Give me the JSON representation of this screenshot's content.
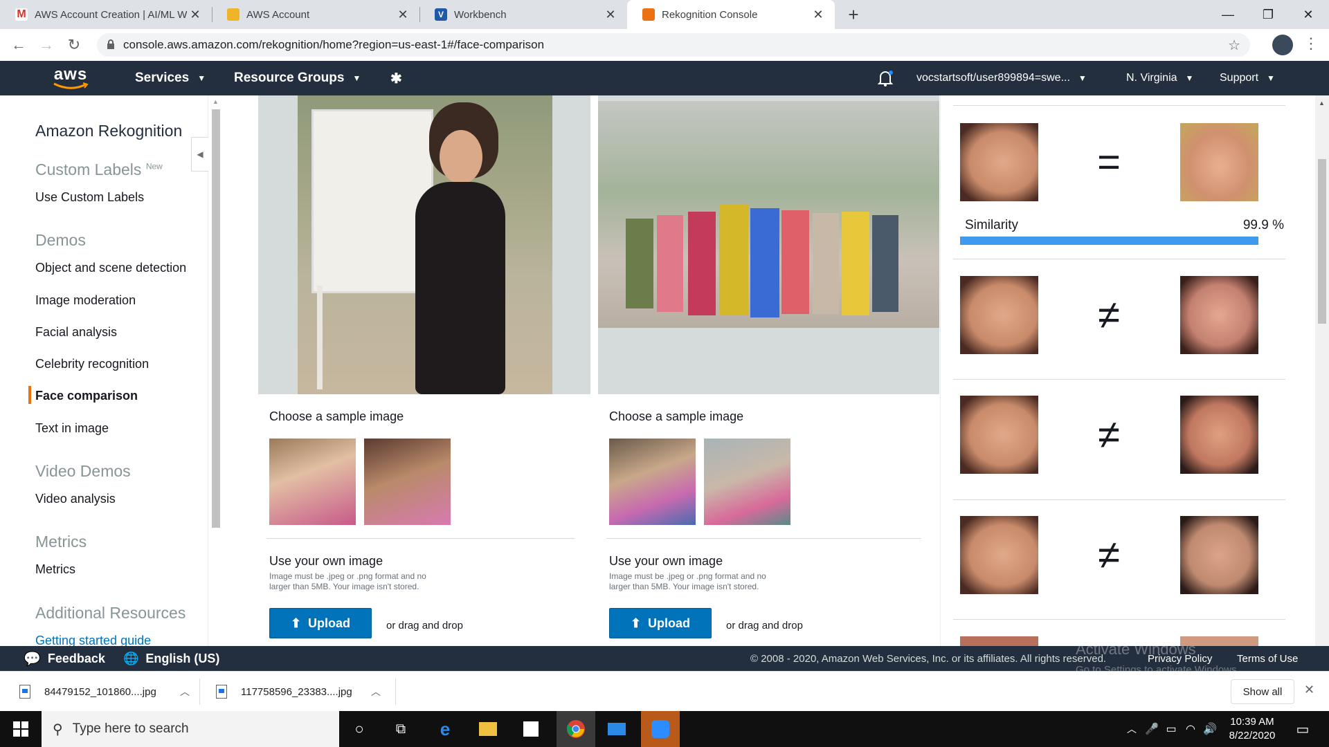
{
  "browser": {
    "tabs": [
      {
        "title": "AWS Account Creation | AI/ML W",
        "favicon": "gmail-icon"
      },
      {
        "title": "AWS Account",
        "favicon": "aws-box-icon"
      },
      {
        "title": "Workbench",
        "favicon": "vocareum-icon"
      },
      {
        "title": "Rekognition Console",
        "favicon": "aws-box-icon",
        "active": true
      }
    ],
    "url": "console.aws.amazon.com/rekognition/home?region=us-east-1#/face-comparison"
  },
  "aws_nav": {
    "logo": "aws",
    "services": "Services",
    "resource_groups": "Resource Groups",
    "account": "vocstartsoft/user899894=swe...",
    "region": "N. Virginia",
    "support": "Support"
  },
  "sidebar": {
    "title": "Amazon Rekognition",
    "custom_labels_head": "Custom Labels",
    "custom_labels_badge": "New",
    "use_custom_labels": "Use Custom Labels",
    "demos_head": "Demos",
    "demos": [
      "Object and scene detection",
      "Image moderation",
      "Facial analysis",
      "Celebrity recognition",
      "Face comparison",
      "Text in image"
    ],
    "active_demo": "Face comparison",
    "video_head": "Video Demos",
    "video_analysis": "Video analysis",
    "metrics_head": "Metrics",
    "metrics": "Metrics",
    "additional_head": "Additional Resources",
    "getting_started": "Getting started guide"
  },
  "left_panel": {
    "sample_title": "Choose a sample image",
    "own_title": "Use your own image",
    "own_note": "Image must be .jpeg or .png format and no larger than 5MB. Your image isn't stored.",
    "upload": "Upload",
    "drag": "or drag and drop"
  },
  "right_panel": {
    "sample_title": "Choose a sample image",
    "own_title": "Use your own image",
    "own_note": "Image must be .jpeg or .png format and no larger than 5MB. Your image isn't stored.",
    "upload": "Upload",
    "drag": "or drag and drop"
  },
  "results": {
    "similarity_label": "Similarity",
    "similarity_value": "99.9 %",
    "similarity_fraction": 0.999,
    "comparisons": [
      "match",
      "no-match",
      "no-match",
      "no-match"
    ],
    "match_symbol": "=",
    "nomatch_symbol": "≠"
  },
  "footer": {
    "feedback": "Feedback",
    "language": "English (US)",
    "copyright": "© 2008 - 2020, Amazon Web Services, Inc. or its affiliates. All rights reserved.",
    "privacy": "Privacy Policy",
    "terms": "Terms of Use",
    "watermark_title": "Activate Windows",
    "watermark_sub": "Go to Settings to activate Windows."
  },
  "downloads": {
    "items": [
      "84479152_101860....jpg",
      "117758596_23383....jpg"
    ],
    "show_all": "Show all"
  },
  "taskbar": {
    "search_placeholder": "Type here to search",
    "time": "10:39 AM",
    "date": "8/22/2020"
  }
}
